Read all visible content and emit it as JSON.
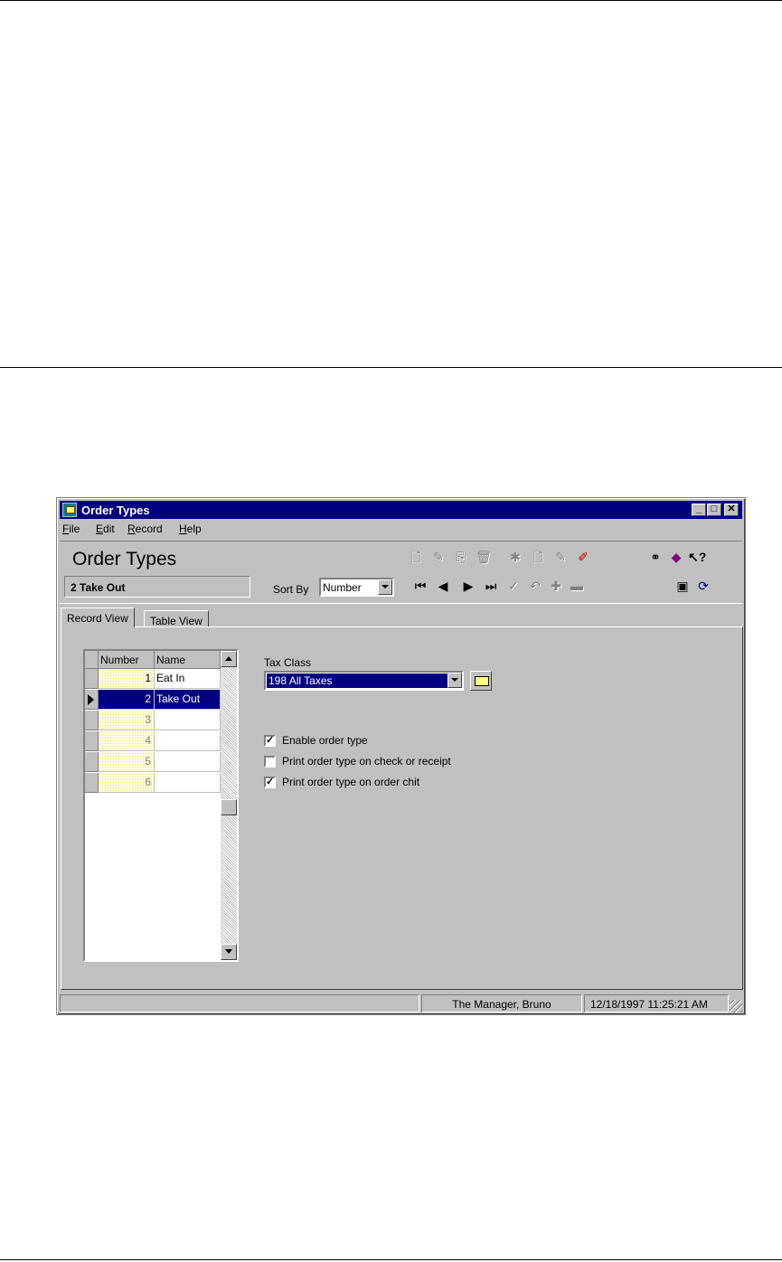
{
  "window": {
    "title": "Order Types"
  },
  "menu": [
    {
      "label": "File",
      "key": "F",
      "rest": "ile"
    },
    {
      "label": "Edit",
      "key": "E",
      "rest": "dit"
    },
    {
      "label": "Record",
      "key": "R",
      "rest": "ecord"
    },
    {
      "label": "Help",
      "key": "H",
      "rest": "elp"
    }
  ],
  "header": {
    "title": "Order Types",
    "current_record": "2  Take Out",
    "sort_by_label": "Sort By",
    "sort_by_value": "Number"
  },
  "tabs": [
    {
      "label": "Record View",
      "active": true
    },
    {
      "label": "Table View",
      "active": false
    }
  ],
  "grid": {
    "columns": [
      "Number",
      "Name"
    ],
    "rows": [
      {
        "number": "1",
        "name": "Eat In"
      },
      {
        "number": "2",
        "name": "Take Out"
      },
      {
        "number": "3",
        "name": ""
      },
      {
        "number": "4",
        "name": ""
      },
      {
        "number": "5",
        "name": ""
      },
      {
        "number": "6",
        "name": ""
      }
    ],
    "selected_row": 2
  },
  "form": {
    "tax_class_label": "Tax Class",
    "tax_class_value": "198  All Taxes",
    "checkboxes": [
      {
        "label": "Enable order type",
        "checked": true
      },
      {
        "label": "Print order type on check or receipt",
        "checked": false
      },
      {
        "label": "Print order type on order chit",
        "checked": true
      }
    ]
  },
  "status": {
    "user": "The Manager, Bruno",
    "datetime": "12/18/1997 11:25:21 AM"
  }
}
